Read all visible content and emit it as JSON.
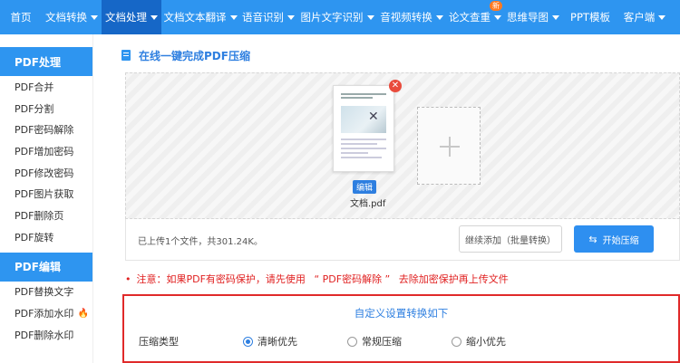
{
  "nav": {
    "items": [
      {
        "label": "首页",
        "has_caret": false
      },
      {
        "label": "文档转换",
        "has_caret": true
      },
      {
        "label": "文档处理",
        "has_caret": true,
        "active": true
      },
      {
        "label": "文档文本翻译",
        "has_caret": true
      },
      {
        "label": "语音识别",
        "has_caret": true
      },
      {
        "label": "图片文字识别",
        "has_caret": true
      },
      {
        "label": "音视频转换",
        "has_caret": true
      },
      {
        "label": "论文查重",
        "has_caret": true,
        "badge": "新"
      },
      {
        "label": "思维导图",
        "has_caret": true
      },
      {
        "label": "PPT模板",
        "has_caret": false
      },
      {
        "label": "客户端",
        "has_caret": true
      }
    ]
  },
  "sidebar": {
    "sections": [
      {
        "header": "PDF处理",
        "items": [
          "PDF合并",
          "PDF分割",
          "PDF密码解除",
          "PDF增加密码",
          "PDF修改密码",
          "PDF图片获取",
          "PDF删除页",
          "PDF旋转"
        ]
      },
      {
        "header": "PDF编辑",
        "items": [
          "PDF替换文字",
          "PDF添加水印",
          "PDF删除水印"
        ]
      }
    ],
    "fire_icon": "🔥"
  },
  "main": {
    "title": "在线一键完成PDF压缩",
    "file": {
      "name": "文档.pdf",
      "edit_label": "编辑"
    },
    "upload_info": "已上传1个文件，共301.24K。",
    "continue_button": "继续添加（批量转换）",
    "start_button": "开始压缩",
    "notice": {
      "bullet": "•",
      "prefix": "注意：如果PDF有密码保护，请先使用",
      "link": "“ PDF密码解除 ”",
      "suffix": "去除加密保护再上传文件"
    },
    "settings": {
      "title": "自定义设置转换如下",
      "label": "压缩类型",
      "options": [
        {
          "label": "清晰优先",
          "checked": true
        },
        {
          "label": "常规压缩",
          "checked": false
        },
        {
          "label": "缩小优先",
          "checked": false
        }
      ]
    }
  },
  "colors": {
    "nav_bg": "#2e95f0",
    "nav_active": "#1667c7",
    "accent": "#2e7fe0",
    "warning": "#e02020",
    "badge": "#ff7a22"
  }
}
